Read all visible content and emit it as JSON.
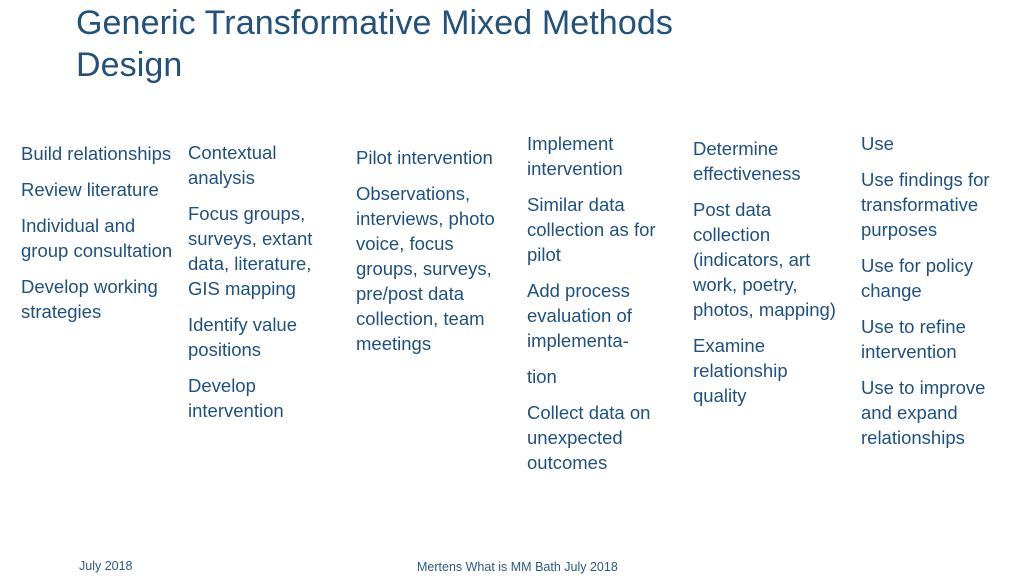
{
  "slide": {
    "title": "Generic Transformative Mixed Methods Design",
    "background_color": "#ffffff",
    "text_color": "#1f5180",
    "title_color": "#22527c"
  },
  "columns": [
    {
      "name": "build-relationships",
      "blocks": [
        "Build relationships",
        "Review literature",
        "Individual and group consultation",
        "Develop working strategies"
      ]
    },
    {
      "name": "contextual-analysis",
      "blocks": [
        "Contextual analysis",
        "Focus groups, surveys, extant data, literature, GIS mapping",
        "Identify value positions",
        "Develop intervention"
      ]
    },
    {
      "name": "pilot-intervention",
      "blocks": [
        "Pilot intervention",
        "Observations, interviews, photo voice, focus groups, surveys, pre/post data collection, team meetings"
      ]
    },
    {
      "name": "implement-intervention",
      "blocks": [
        "Implement intervention",
        "Similar data collection as for pilot",
        "Add process evaluation of implementa-",
        "tion",
        "Collect data on unexpected outcomes"
      ]
    },
    {
      "name": "determine-effectiveness",
      "blocks": [
        "Determine effectiveness",
        "Post data collection (indicators, art work, poetry, photos, mapping)",
        "Examine relationship quality"
      ]
    },
    {
      "name": "use",
      "blocks": [
        "Use",
        "Use findings for transformative purposes",
        "Use for policy change",
        "Use to refine intervention",
        "Use to improve and expand relationships"
      ]
    }
  ],
  "footer": {
    "left": "July 2018",
    "center": "Mertens What is MM Bath July 2018"
  }
}
